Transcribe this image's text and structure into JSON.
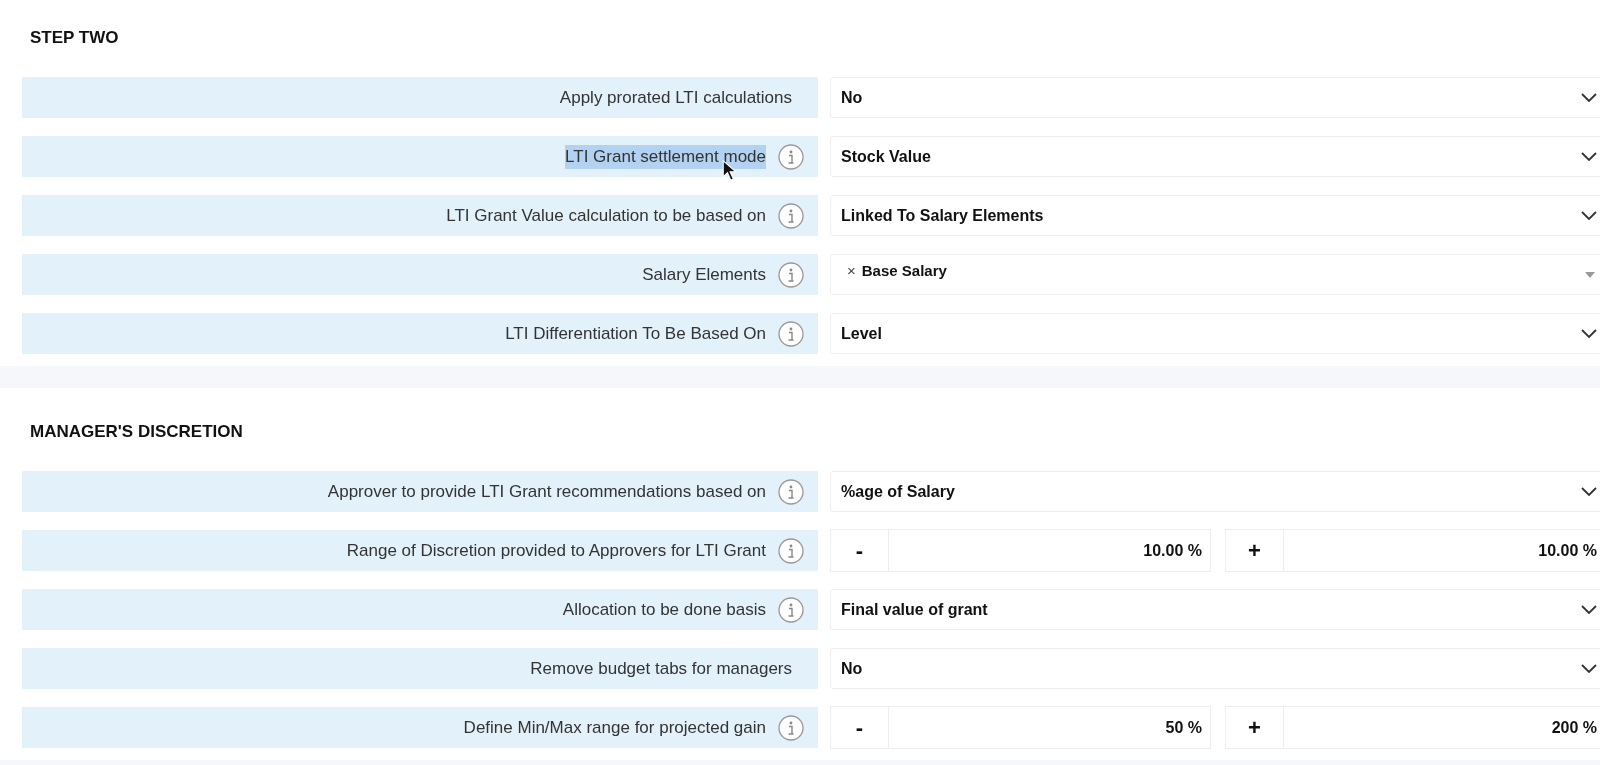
{
  "sections": [
    {
      "title": "STEP TWO",
      "rows": [
        {
          "label": "Apply prorated LTI calculations",
          "info": false,
          "highlighted": false,
          "kind": "select",
          "value": "No"
        },
        {
          "label": "LTI Grant settlement mode",
          "info": true,
          "highlighted": true,
          "kind": "select",
          "value": "Stock Value"
        },
        {
          "label": "LTI Grant Value calculation to be based on",
          "info": true,
          "highlighted": false,
          "kind": "select",
          "value": "Linked To Salary Elements"
        },
        {
          "label": "Salary Elements",
          "info": true,
          "highlighted": false,
          "kind": "tags",
          "remove": "×",
          "tags": [
            "Base Salary"
          ]
        },
        {
          "label": "LTI Differentiation To Be Based On",
          "info": true,
          "highlighted": false,
          "kind": "select",
          "value": "Level"
        }
      ]
    },
    {
      "title": "MANAGER'S DISCRETION",
      "rows": [
        {
          "label": "Approver to provide LTI Grant recommendations based on",
          "info": true,
          "highlighted": false,
          "kind": "select",
          "value": "%age of Salary"
        },
        {
          "label": "Range of Discretion provided to Approvers for LTI Grant",
          "info": true,
          "highlighted": false,
          "kind": "range",
          "minus": "-",
          "min": "10.00 %",
          "plus": "+",
          "max": "10.00 %"
        },
        {
          "label": "Allocation to be done basis",
          "info": true,
          "highlighted": false,
          "kind": "select",
          "value": "Final value of grant"
        },
        {
          "label": "Remove budget tabs for managers",
          "info": false,
          "highlighted": false,
          "kind": "select",
          "value": "No"
        },
        {
          "label": "Define Min/Max range for projected gain",
          "info": true,
          "highlighted": false,
          "kind": "range",
          "minus": "-",
          "min": "50 %",
          "plus": "+",
          "max": "200 %"
        }
      ]
    }
  ]
}
